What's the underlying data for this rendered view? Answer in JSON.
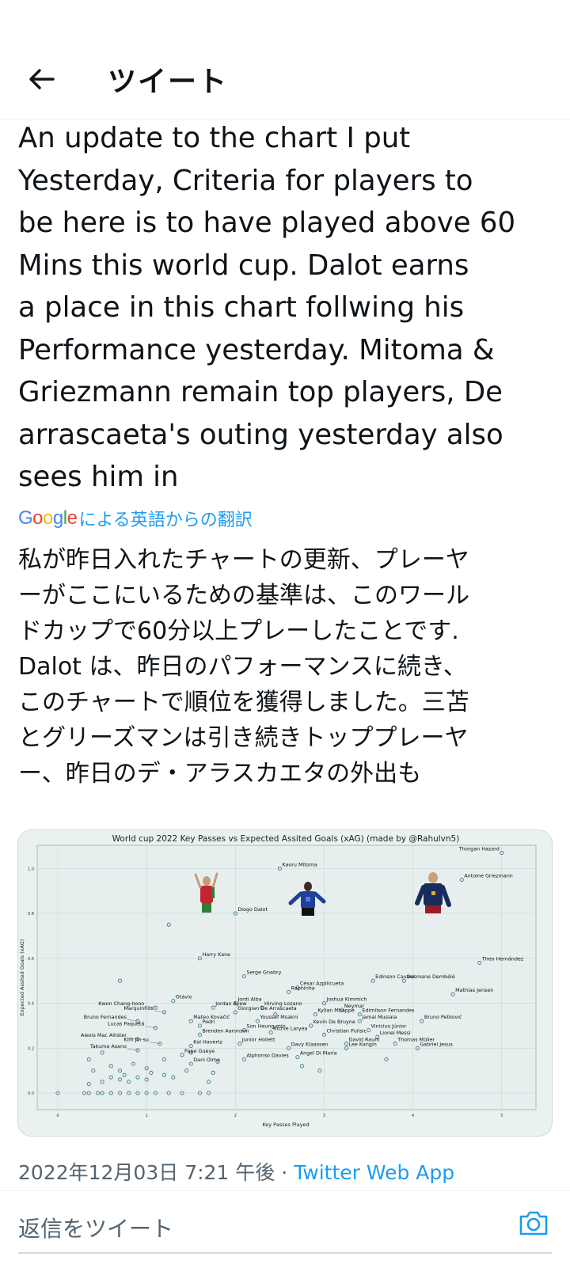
{
  "header": {
    "title": "ツイート",
    "back_icon": "arrow-left-icon"
  },
  "tweet": {
    "text": "An update to the chart I put\nYesterday, Criteria for players to\nbe here is to have played above 60\nMins this world cup. Dalot earns\na place in this chart follwing his\nPerformance yesterday. Mitoma &\nGriezmann remain top players, De\narrascaeta's outing yesterday also\nsees him in",
    "translation_source": "Google",
    "translation_label": "による英語からの翻訳",
    "translated_text": "私が昨日入れたチャートの更新、プレーヤ\nーがここにいるための基準は、このワール\nドカップで60分以上プレーしたことです.\nDalot は、昨日のパフォーマンスに続き、\nこのチャートで順位を獲得しました。三苫\nとグリーズマンは引き続きトッププレーヤ\nー、昨日のデ・アラスカエタの外出も",
    "timestamp": "2022年12月03日 7:21 午後",
    "separator": " · ",
    "app": "Twitter Web App"
  },
  "reply": {
    "placeholder": "返信をツイート",
    "camera_icon": "camera-icon"
  },
  "colors": {
    "accent": "#1d9bf0",
    "muted": "#536471",
    "point": "#3a7d7b",
    "chart_bg": "#e9f2f1"
  },
  "chart_data": {
    "type": "scatter",
    "title": "World cup 2022 Key Passes vs Expected Assited Goals (xAG) (made by @Rahulvn5)",
    "xlabel": "Key Passes Played",
    "ylabel": "Expected Assited Goals (xAG)",
    "xlim": [
      0,
      5.1
    ],
    "ylim": [
      0,
      1.1
    ],
    "x_ticks": [
      0,
      1,
      2,
      3,
      4,
      5
    ],
    "x_tick_labels": [
      "0",
      "1",
      "2",
      "3",
      "4",
      "5"
    ],
    "y_ticks": [
      0.0,
      0.2,
      0.4,
      0.6,
      0.8,
      1.0
    ],
    "y_tick_labels": [
      "0.0",
      "0.2",
      "0.4",
      "0.6",
      "0.8",
      "1.0"
    ],
    "grid": true,
    "labeled_points": [
      {
        "name": "Thorgan Hazard",
        "x": 5.0,
        "y": 1.07
      },
      {
        "name": "Kaoru Mitoma",
        "x": 2.5,
        "y": 1.0
      },
      {
        "name": "Antoine Griezmann",
        "x": 4.55,
        "y": 0.95
      },
      {
        "name": "Diogo Dalot",
        "x": 2.0,
        "y": 0.8
      },
      {
        "name": "Harry Kane",
        "x": 1.6,
        "y": 0.6
      },
      {
        "name": "Theo Hernández",
        "x": 4.75,
        "y": 0.58
      },
      {
        "name": "Serge Gnabry",
        "x": 2.1,
        "y": 0.52
      },
      {
        "name": "Edinson Cavani",
        "x": 3.55,
        "y": 0.5
      },
      {
        "name": "Ousmane Dembélé",
        "x": 3.9,
        "y": 0.5
      },
      {
        "name": "Mathias Jensen",
        "x": 4.45,
        "y": 0.44
      },
      {
        "name": "César Azpilicueta",
        "x": 2.7,
        "y": 0.47
      },
      {
        "name": "Raphinha",
        "x": 2.6,
        "y": 0.45
      },
      {
        "name": "Otávio",
        "x": 1.3,
        "y": 0.41
      },
      {
        "name": "Jordi Alba",
        "x": 2.0,
        "y": 0.4
      },
      {
        "name": "Joshua Kimmich",
        "x": 3.0,
        "y": 0.4
      },
      {
        "name": "Kwon Chang-hoon",
        "x": 1.1,
        "y": 0.38
      },
      {
        "name": "Jordan Ayew",
        "x": 1.75,
        "y": 0.38
      },
      {
        "name": "Hirving Lozano",
        "x": 2.3,
        "y": 0.38
      },
      {
        "name": "Neymar",
        "x": 3.2,
        "y": 0.37
      },
      {
        "name": "Marquinhos",
        "x": 1.2,
        "y": 0.36
      },
      {
        "name": "Giorgian De Arrascaeta",
        "x": 2.0,
        "y": 0.36
      },
      {
        "name": "Kylian Mbappé",
        "x": 2.9,
        "y": 0.35
      },
      {
        "name": "Edimilson Fernandes",
        "x": 3.4,
        "y": 0.35
      },
      {
        "name": "Bruno Fernandes",
        "x": 0.9,
        "y": 0.32
      },
      {
        "name": "Mateo Kovačić",
        "x": 1.5,
        "y": 0.32
      },
      {
        "name": "Youssef Msakni",
        "x": 2.25,
        "y": 0.32
      },
      {
        "name": "Jamal Musiala",
        "x": 3.4,
        "y": 0.32
      },
      {
        "name": "Bruno Petković",
        "x": 4.1,
        "y": 0.32
      },
      {
        "name": "Pedri",
        "x": 1.6,
        "y": 0.3
      },
      {
        "name": "Kevin De Bruyne",
        "x": 2.85,
        "y": 0.3
      },
      {
        "name": "Lucas Paquetá",
        "x": 1.1,
        "y": 0.29
      },
      {
        "name": "Son Heung-min",
        "x": 2.1,
        "y": 0.28
      },
      {
        "name": "Vinicius Júnior",
        "x": 3.5,
        "y": 0.28
      },
      {
        "name": "Richie Laryea",
        "x": 2.4,
        "y": 0.27
      },
      {
        "name": "Brenden Aaronson",
        "x": 1.6,
        "y": 0.26
      },
      {
        "name": "Christian Pulisic",
        "x": 3.0,
        "y": 0.26
      },
      {
        "name": "Lionel Messi",
        "x": 3.6,
        "y": 0.25
      },
      {
        "name": "Alexis Mac Allister",
        "x": 0.9,
        "y": 0.24
      },
      {
        "name": "Junior Hoilett",
        "x": 2.05,
        "y": 0.22
      },
      {
        "name": "Thomas Müller",
        "x": 3.8,
        "y": 0.22
      },
      {
        "name": "Kim Jin-su",
        "x": 1.15,
        "y": 0.22
      },
      {
        "name": "David Raum",
        "x": 3.25,
        "y": 0.22
      },
      {
        "name": "Kai Havertz",
        "x": 1.5,
        "y": 0.21
      },
      {
        "name": "Davy Klaassen",
        "x": 2.6,
        "y": 0.2
      },
      {
        "name": "Lee Kangin",
        "x": 3.25,
        "y": 0.2
      },
      {
        "name": "Gabriel Jesus",
        "x": 4.05,
        "y": 0.2
      },
      {
        "name": "Takuma Asano",
        "x": 0.9,
        "y": 0.19
      },
      {
        "name": "Pape Gueye",
        "x": 1.4,
        "y": 0.17
      },
      {
        "name": "Angel Di María",
        "x": 2.7,
        "y": 0.16
      },
      {
        "name": "Alphonso Davies",
        "x": 2.1,
        "y": 0.15
      },
      {
        "name": "Dani Olmo",
        "x": 1.5,
        "y": 0.13
      }
    ],
    "unlabeled_points": [
      {
        "x": 0.0,
        "y": 0.0
      },
      {
        "x": 0.3,
        "y": 0.0
      },
      {
        "x": 0.35,
        "y": 0.0
      },
      {
        "x": 0.45,
        "y": 0.0
      },
      {
        "x": 0.5,
        "y": 0.0
      },
      {
        "x": 0.6,
        "y": 0.0
      },
      {
        "x": 0.7,
        "y": 0.0
      },
      {
        "x": 0.8,
        "y": 0.0
      },
      {
        "x": 0.9,
        "y": 0.0
      },
      {
        "x": 1.0,
        "y": 0.0
      },
      {
        "x": 1.1,
        "y": 0.0
      },
      {
        "x": 1.25,
        "y": 0.0
      },
      {
        "x": 1.4,
        "y": 0.0
      },
      {
        "x": 1.6,
        "y": 0.0
      },
      {
        "x": 1.7,
        "y": 0.0
      },
      {
        "x": 0.35,
        "y": 0.04
      },
      {
        "x": 0.5,
        "y": 0.05
      },
      {
        "x": 0.6,
        "y": 0.07
      },
      {
        "x": 0.7,
        "y": 0.06
      },
      {
        "x": 0.75,
        "y": 0.08
      },
      {
        "x": 0.8,
        "y": 0.05
      },
      {
        "x": 0.9,
        "y": 0.07
      },
      {
        "x": 1.0,
        "y": 0.06
      },
      {
        "x": 1.05,
        "y": 0.09
      },
      {
        "x": 1.2,
        "y": 0.08
      },
      {
        "x": 0.4,
        "y": 0.1
      },
      {
        "x": 0.6,
        "y": 0.12
      },
      {
        "x": 0.7,
        "y": 0.1
      },
      {
        "x": 0.85,
        "y": 0.13
      },
      {
        "x": 1.0,
        "y": 0.11
      },
      {
        "x": 1.3,
        "y": 0.07
      },
      {
        "x": 1.45,
        "y": 0.1
      },
      {
        "x": 1.7,
        "y": 0.05
      },
      {
        "x": 1.75,
        "y": 0.09
      },
      {
        "x": 1.8,
        "y": 0.14
      },
      {
        "x": 1.2,
        "y": 0.15
      },
      {
        "x": 1.5,
        "y": 0.18
      },
      {
        "x": 0.35,
        "y": 0.15
      },
      {
        "x": 0.5,
        "y": 0.18
      },
      {
        "x": 2.75,
        "y": 0.12
      },
      {
        "x": 3.7,
        "y": 0.15
      },
      {
        "x": 2.95,
        "y": 0.1
      },
      {
        "x": 1.25,
        "y": 0.75
      },
      {
        "x": 0.7,
        "y": 0.5
      },
      {
        "x": 2.45,
        "y": 0.35
      }
    ],
    "images": [
      "dalot-photo",
      "mitoma-photo",
      "griezmann-photo"
    ]
  }
}
